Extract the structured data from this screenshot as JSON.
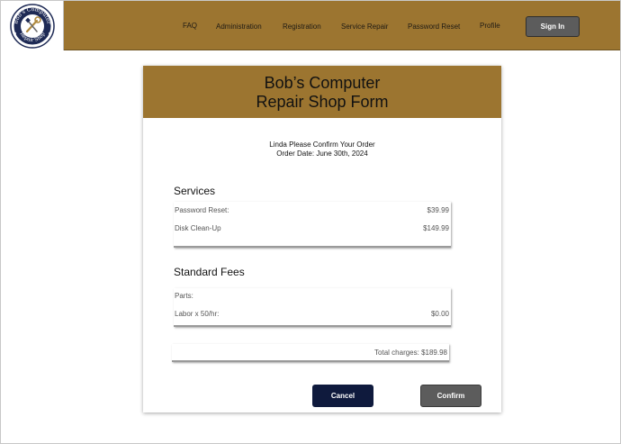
{
  "logo": {
    "text_top": "Bob's Computer",
    "text_bottom": "Repair Shop",
    "icon": "wrench-screwdriver-icon"
  },
  "nav": {
    "items": [
      "FAQ",
      "Administration",
      "Registration",
      "Service Repair",
      "Password Reset",
      "Profile"
    ],
    "sign_in_label": "Sign In"
  },
  "form": {
    "title_line1": "Bob’s Computer",
    "title_line2": "Repair Shop Form",
    "confirm_message": "Linda Please Confirm Your Order",
    "order_date": "Order Date: June 30th, 2024",
    "services": {
      "heading": "Services",
      "rows": [
        {
          "label": "Password Reset:",
          "amount": "$39.99"
        },
        {
          "label": "Disk Clean-Up",
          "amount": "$149.99"
        }
      ]
    },
    "fees": {
      "heading": "Standard Fees",
      "rows": [
        {
          "label": "Parts:",
          "amount": ""
        },
        {
          "label": "Labor x 50/hr:",
          "amount": "$0.00"
        }
      ]
    },
    "total": "Total charges: $189.98",
    "cancel_label": "Cancel",
    "confirm_label": "Confirm"
  },
  "colors": {
    "brand_gold": "#9c7530",
    "cancel_navy": "#0f1a3d",
    "button_gray": "#5c5c5c"
  }
}
